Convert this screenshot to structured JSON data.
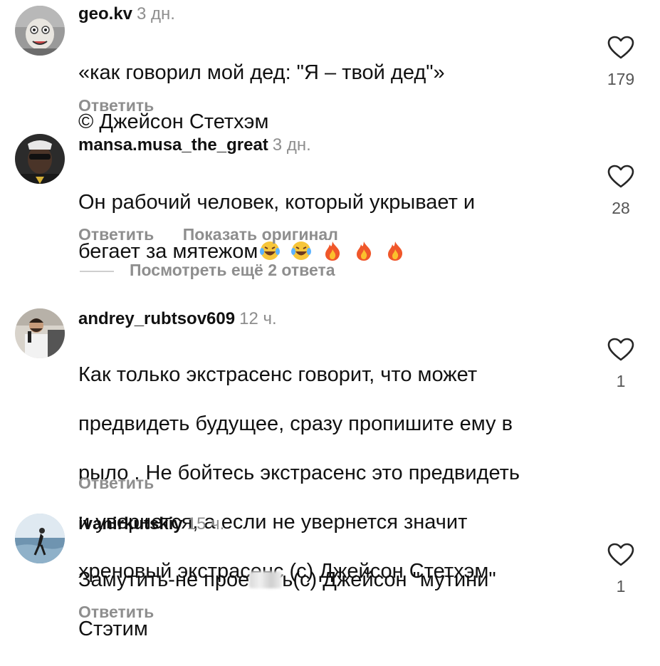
{
  "comments": [
    {
      "username": "geo.kv",
      "time": "3 дн.",
      "text_lines": [
        "«как говорил мой дед: \"Я – твой дед\"»",
        "© Джейсон Стетхэм"
      ],
      "like_count": "179",
      "actions": [
        "Ответить"
      ]
    },
    {
      "username": "mansa.musa_the_great",
      "time": "3 дн.",
      "text_lines": [
        "Он рабочий человек, который укрывает и",
        "бегает за мятежом"
      ],
      "emojis": [
        "laughing-tears-emoji",
        "laughing-tears-emoji",
        "fire-emoji",
        "fire-emoji",
        "fire-emoji"
      ],
      "like_count": "28",
      "actions": [
        "Ответить",
        "Показать оригинал"
      ]
    },
    {
      "username": "andrey_rubtsov609",
      "time": "12 ч.",
      "text_lines": [
        "Как только экстрасенс говорит, что может",
        "предвидеть будущее, сразу пропишите ему в",
        "рыло . Не бойтесь экстрасенс это предвидеть",
        "и увернется, а если не увернется значит",
        "хреновый экстрасенс (с) Джейсон Стетхэм"
      ],
      "like_count": "1",
      "actions": [
        "Ответить"
      ]
    },
    {
      "username": "ivanirkutskiy",
      "time": "15 ч.",
      "text_line1_before": "Замутить-не прое",
      "text_line1_after": "ь(с) Джейсон \"мутини\"",
      "text_line2": "Стэтим",
      "like_count": "1",
      "actions": [
        "Ответить"
      ]
    }
  ],
  "more_replies": "Посмотреть ещё 2 ответа",
  "colors": {
    "text": "#111111",
    "muted": "#8e8e8e",
    "heart_stroke": "#262626"
  }
}
